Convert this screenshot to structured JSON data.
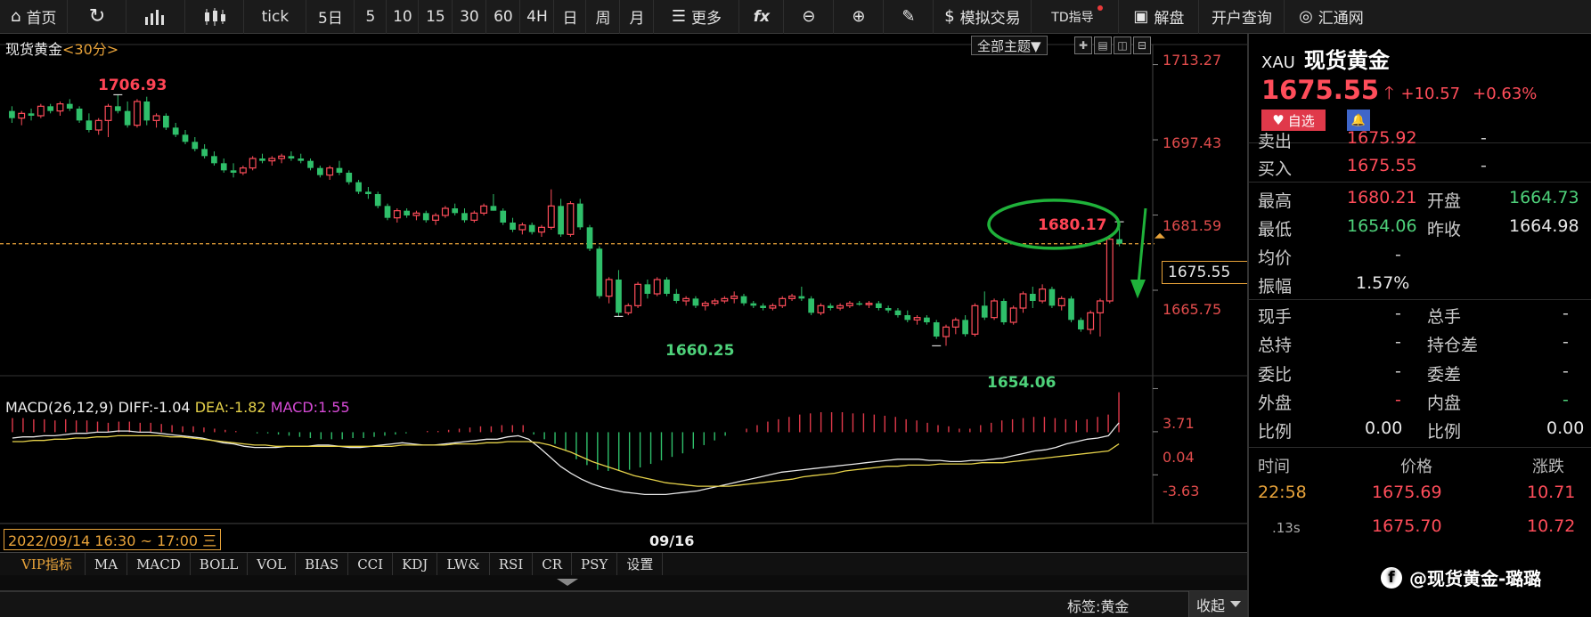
{
  "toolbar": {
    "home": "首页",
    "tick": "tick",
    "periods": [
      "5日",
      "5",
      "10",
      "15",
      "30",
      "60",
      "4H",
      "日",
      "周",
      "月"
    ],
    "more": "更多",
    "fx": "fx",
    "sim_trade": "模拟交易",
    "td_guide": "TD指导",
    "analysis": "解盘",
    "account": "开户查询",
    "huitong": "汇通网"
  },
  "chart": {
    "title": "现货黄金",
    "timeframe": "<30分>",
    "theme_button": "全部主题▼",
    "y_labels": [
      "1713.27",
      "1697.43",
      "1681.59",
      "1665.75"
    ],
    "current_price_box": "1675.55",
    "annotations": {
      "high_left": "1706.93",
      "high_right": "1680.17",
      "low_left": "1660.25",
      "low_right": "1654.06"
    },
    "macd_legend": {
      "params": "MACD(26,12,9)",
      "diff": "DIFF:-1.04",
      "dea": "DEA:-1.82",
      "macd": "MACD:1.55"
    },
    "macd_y_labels": [
      "3.71",
      "0.04",
      "-3.63"
    ],
    "time_start": "2022/09/14 16:30 ~ 17:00 三",
    "time_mid": "09/16"
  },
  "chart_data": {
    "type": "candlestick",
    "title": "现货黄金",
    "ylim": [
      1650,
      1716
    ],
    "yticks": [
      1713.27,
      1697.43,
      1681.59,
      1665.75
    ],
    "current_price": 1675.55,
    "candles": [
      [
        1703.5,
        1704.5,
        1701.0,
        1702.0
      ],
      [
        1702.0,
        1703.5,
        1700.5,
        1703.0
      ],
      [
        1703.0,
        1704.0,
        1701.5,
        1702.5
      ],
      [
        1702.5,
        1705.0,
        1702.0,
        1704.5
      ],
      [
        1704.5,
        1705.0,
        1703.0,
        1703.5
      ],
      [
        1703.5,
        1705.5,
        1702.5,
        1705.0
      ],
      [
        1705.0,
        1706.0,
        1703.5,
        1704.0
      ],
      [
        1704.0,
        1704.5,
        1701.0,
        1701.5
      ],
      [
        1701.5,
        1703.0,
        1699.0,
        1699.5
      ],
      [
        1699.5,
        1702.0,
        1698.5,
        1701.5
      ],
      [
        1701.5,
        1705.0,
        1698.0,
        1704.5
      ],
      [
        1704.5,
        1706.9,
        1703.0,
        1703.5
      ],
      [
        1703.5,
        1705.5,
        1700.0,
        1700.5
      ],
      [
        1700.5,
        1706.0,
        1700.0,
        1705.5
      ],
      [
        1705.5,
        1706.5,
        1700.5,
        1701.5
      ],
      [
        1701.5,
        1703.0,
        1700.0,
        1702.5
      ],
      [
        1702.5,
        1703.0,
        1699.5,
        1700.0
      ],
      [
        1700.0,
        1701.0,
        1698.0,
        1698.5
      ],
      [
        1698.5,
        1699.5,
        1696.5,
        1697.0
      ],
      [
        1697.0,
        1698.0,
        1695.0,
        1695.5
      ],
      [
        1695.5,
        1696.5,
        1693.5,
        1694.0
      ],
      [
        1694.0,
        1695.0,
        1692.0,
        1692.5
      ],
      [
        1692.5,
        1693.5,
        1690.5,
        1691.0
      ],
      [
        1691.0,
        1692.5,
        1689.5,
        1690.5
      ],
      [
        1690.5,
        1692.0,
        1690.0,
        1691.5
      ],
      [
        1691.5,
        1694.0,
        1691.0,
        1693.5
      ],
      [
        1693.5,
        1694.5,
        1692.5,
        1693.0
      ],
      [
        1693.0,
        1694.0,
        1692.0,
        1693.5
      ],
      [
        1693.5,
        1694.5,
        1692.5,
        1694.0
      ],
      [
        1694.0,
        1695.0,
        1693.0,
        1693.5
      ],
      [
        1693.5,
        1694.5,
        1692.5,
        1693.0
      ],
      [
        1693.0,
        1693.5,
        1691.0,
        1691.5
      ],
      [
        1691.5,
        1692.0,
        1689.5,
        1690.0
      ],
      [
        1690.0,
        1692.0,
        1689.0,
        1691.5
      ],
      [
        1691.5,
        1693.0,
        1690.0,
        1690.5
      ],
      [
        1690.5,
        1691.0,
        1688.0,
        1688.5
      ],
      [
        1688.5,
        1689.0,
        1686.0,
        1686.5
      ],
      [
        1686.5,
        1687.5,
        1685.0,
        1686.0
      ],
      [
        1686.0,
        1686.5,
        1683.0,
        1683.5
      ],
      [
        1683.5,
        1684.0,
        1680.5,
        1681.0
      ],
      [
        1681.0,
        1683.0,
        1680.0,
        1682.5
      ],
      [
        1682.5,
        1683.0,
        1681.0,
        1681.5
      ],
      [
        1681.5,
        1682.5,
        1680.5,
        1682.0
      ],
      [
        1682.0,
        1682.5,
        1680.0,
        1680.5
      ],
      [
        1680.5,
        1682.0,
        1679.5,
        1681.5
      ],
      [
        1681.5,
        1683.5,
        1681.0,
        1683.0
      ],
      [
        1683.0,
        1684.0,
        1681.5,
        1682.0
      ],
      [
        1682.0,
        1683.0,
        1680.0,
        1680.5
      ],
      [
        1680.5,
        1682.5,
        1680.0,
        1682.0
      ],
      [
        1682.0,
        1684.0,
        1681.5,
        1683.5
      ],
      [
        1683.5,
        1686.0,
        1682.5,
        1682.5
      ],
      [
        1682.5,
        1683.0,
        1679.5,
        1680.0
      ],
      [
        1680.0,
        1681.0,
        1678.0,
        1678.5
      ],
      [
        1678.5,
        1680.0,
        1677.5,
        1679.5
      ],
      [
        1679.5,
        1680.0,
        1677.5,
        1678.0
      ],
      [
        1678.0,
        1679.5,
        1677.0,
        1679.0
      ],
      [
        1679.0,
        1687.0,
        1678.5,
        1683.5
      ],
      [
        1683.5,
        1685.0,
        1677.0,
        1677.5
      ],
      [
        1677.5,
        1684.5,
        1677.0,
        1684.0
      ],
      [
        1684.0,
        1685.0,
        1678.5,
        1679.0
      ],
      [
        1679.0,
        1679.5,
        1674.0,
        1674.5
      ],
      [
        1674.5,
        1675.0,
        1664.0,
        1664.5
      ],
      [
        1664.5,
        1668.5,
        1663.0,
        1668.0
      ],
      [
        1668.0,
        1670.0,
        1660.25,
        1661.0
      ],
      [
        1661.0,
        1663.0,
        1660.5,
        1662.5
      ],
      [
        1662.5,
        1667.5,
        1662.0,
        1667.0
      ],
      [
        1667.0,
        1668.0,
        1664.0,
        1665.0
      ],
      [
        1665.0,
        1668.5,
        1664.5,
        1668.0
      ],
      [
        1668.0,
        1668.5,
        1664.5,
        1665.0
      ],
      [
        1665.0,
        1666.0,
        1663.0,
        1663.5
      ],
      [
        1663.5,
        1664.5,
        1662.5,
        1664.0
      ],
      [
        1664.0,
        1664.5,
        1662.0,
        1662.5
      ],
      [
        1662.5,
        1663.5,
        1661.5,
        1663.0
      ],
      [
        1663.0,
        1664.0,
        1662.5,
        1663.5
      ],
      [
        1663.5,
        1664.5,
        1663.0,
        1664.0
      ],
      [
        1664.0,
        1665.5,
        1663.0,
        1664.5
      ],
      [
        1664.5,
        1665.0,
        1662.5,
        1663.0
      ],
      [
        1663.0,
        1663.5,
        1662.0,
        1662.5
      ],
      [
        1662.5,
        1663.0,
        1661.5,
        1662.0
      ],
      [
        1662.0,
        1663.0,
        1661.5,
        1662.5
      ],
      [
        1662.5,
        1664.5,
        1662.0,
        1664.0
      ],
      [
        1664.0,
        1665.0,
        1663.5,
        1664.5
      ],
      [
        1664.5,
        1666.5,
        1663.5,
        1664.0
      ],
      [
        1664.0,
        1664.5,
        1660.5,
        1661.0
      ],
      [
        1661.0,
        1663.0,
        1660.5,
        1662.5
      ],
      [
        1662.5,
        1663.0,
        1661.5,
        1662.0
      ],
      [
        1662.0,
        1663.0,
        1661.5,
        1662.5
      ],
      [
        1662.5,
        1663.5,
        1662.0,
        1663.0
      ],
      [
        1663.0,
        1663.5,
        1662.5,
        1662.8
      ],
      [
        1662.8,
        1663.5,
        1662.0,
        1663.0
      ],
      [
        1663.0,
        1663.5,
        1661.5,
        1662.0
      ],
      [
        1662.0,
        1662.5,
        1661.0,
        1661.5
      ],
      [
        1661.5,
        1662.0,
        1660.0,
        1660.5
      ],
      [
        1660.5,
        1661.5,
        1659.0,
        1659.5
      ],
      [
        1659.5,
        1660.5,
        1658.5,
        1660.0
      ],
      [
        1660.0,
        1660.5,
        1658.5,
        1659.0
      ],
      [
        1659.0,
        1659.5,
        1655.5,
        1656.0
      ],
      [
        1656.0,
        1658.5,
        1654.06,
        1658.0
      ],
      [
        1658.0,
        1660.0,
        1656.5,
        1659.5
      ],
      [
        1659.5,
        1660.5,
        1656.0,
        1656.5
      ],
      [
        1656.5,
        1663.0,
        1656.0,
        1662.5
      ],
      [
        1662.5,
        1665.5,
        1659.5,
        1660.0
      ],
      [
        1660.0,
        1664.0,
        1659.5,
        1663.5
      ],
      [
        1663.5,
        1664.0,
        1658.5,
        1659.0
      ],
      [
        1659.0,
        1662.5,
        1658.5,
        1662.0
      ],
      [
        1662.0,
        1665.5,
        1661.0,
        1665.0
      ],
      [
        1665.0,
        1666.5,
        1662.0,
        1663.5
      ],
      [
        1663.5,
        1667.0,
        1663.0,
        1666.0
      ],
      [
        1666.0,
        1666.5,
        1662.0,
        1662.5
      ],
      [
        1662.5,
        1664.5,
        1661.5,
        1664.0
      ],
      [
        1664.0,
        1664.5,
        1659.0,
        1659.5
      ],
      [
        1659.5,
        1660.0,
        1657.0,
        1657.5
      ],
      [
        1657.5,
        1661.5,
        1656.5,
        1661.0
      ],
      [
        1661.0,
        1664.0,
        1656.0,
        1663.5
      ],
      [
        1663.5,
        1677.0,
        1663.0,
        1676.5
      ],
      [
        1676.5,
        1680.17,
        1675.0,
        1675.55
      ]
    ],
    "macd_ylim": [
      -5.5,
      4.2
    ],
    "macd_hist": [
      1.2,
      1.2,
      1.1,
      1.1,
      1.0,
      1.1,
      1.0,
      1.0,
      0.9,
      0.8,
      0.9,
      0.9,
      0.8,
      0.8,
      0.7,
      0.6,
      0.5,
      0.5,
      0.4,
      0.3,
      0.2,
      0.1,
      0.0,
      -0.1,
      -0.1,
      -0.2,
      -0.3,
      -0.4,
      -0.5,
      -0.6,
      -0.6,
      -0.6,
      -0.5,
      -0.5,
      -0.4,
      -0.3,
      -0.2,
      -0.1,
      0.0,
      0.1,
      0.1,
      0.2,
      0.3,
      0.4,
      0.5,
      0.5,
      0.6,
      0.6,
      0.6,
      -0.2,
      -0.6,
      -1.0,
      -1.6,
      -2.3,
      -2.8,
      -3.2,
      -3.3,
      -3.3,
      -3.2,
      -3.0,
      -2.7,
      -2.4,
      -2.1,
      -1.8,
      -1.4,
      -1.1,
      -0.7,
      -0.3,
      0.0,
      0.3,
      0.6,
      0.9,
      1.1,
      1.3,
      1.5,
      1.6,
      1.7,
      1.7,
      1.7,
      1.6,
      1.6,
      1.5,
      1.4,
      1.3,
      1.1,
      1.0,
      0.8,
      0.6,
      0.5,
      0.3,
      0.3,
      0.6,
      0.8,
      1.0,
      1.1,
      1.2,
      1.3,
      1.3,
      1.2,
      1.1,
      1.0,
      1.1,
      1.3,
      1.5,
      3.4
    ],
    "diff": [
      -0.5,
      -0.4,
      -0.4,
      -0.3,
      -0.3,
      -0.2,
      -0.1,
      -0.1,
      0.0,
      0.0,
      0.1,
      0.1,
      0.0,
      0.0,
      -0.1,
      -0.2,
      -0.3,
      -0.4,
      -0.5,
      -0.7,
      -0.9,
      -1.0,
      -1.2,
      -1.3,
      -1.3,
      -1.3,
      -1.2,
      -1.2,
      -1.2,
      -1.1,
      -1.1,
      -1.2,
      -1.3,
      -1.3,
      -1.2,
      -1.1,
      -1.0,
      -0.9,
      -1.0,
      -1.1,
      -1.1,
      -1.0,
      -0.9,
      -0.8,
      -0.7,
      -0.6,
      -0.6,
      -0.4,
      -0.3,
      -0.6,
      -1.3,
      -2.1,
      -2.9,
      -3.5,
      -4.0,
      -4.4,
      -4.7,
      -4.9,
      -5.1,
      -5.2,
      -5.3,
      -5.3,
      -5.3,
      -5.2,
      -5.1,
      -5.0,
      -4.8,
      -4.6,
      -4.4,
      -4.2,
      -4.0,
      -3.8,
      -3.6,
      -3.4,
      -3.3,
      -3.2,
      -3.1,
      -3.0,
      -2.9,
      -2.8,
      -2.7,
      -2.6,
      -2.5,
      -2.4,
      -2.3,
      -2.3,
      -2.3,
      -2.4,
      -2.4,
      -2.5,
      -2.5,
      -2.4,
      -2.4,
      -2.3,
      -2.2,
      -2.0,
      -1.8,
      -1.6,
      -1.5,
      -1.3,
      -1.0,
      -0.8,
      -0.6,
      -0.5,
      -0.3,
      0.8
    ],
    "dea": [
      -0.8,
      -0.8,
      -0.7,
      -0.7,
      -0.6,
      -0.6,
      -0.5,
      -0.5,
      -0.4,
      -0.4,
      -0.3,
      -0.3,
      -0.3,
      -0.3,
      -0.3,
      -0.4,
      -0.4,
      -0.5,
      -0.6,
      -0.7,
      -0.8,
      -0.9,
      -1.0,
      -1.1,
      -1.1,
      -1.2,
      -1.2,
      -1.2,
      -1.2,
      -1.2,
      -1.2,
      -1.2,
      -1.2,
      -1.2,
      -1.2,
      -1.2,
      -1.2,
      -1.1,
      -1.1,
      -1.1,
      -1.1,
      -1.1,
      -1.0,
      -1.0,
      -1.0,
      -0.9,
      -0.9,
      -0.8,
      -0.8,
      -0.8,
      -0.9,
      -1.1,
      -1.4,
      -1.7,
      -2.1,
      -2.5,
      -2.8,
      -3.1,
      -3.4,
      -3.7,
      -3.9,
      -4.1,
      -4.3,
      -4.4,
      -4.5,
      -4.6,
      -4.6,
      -4.6,
      -4.6,
      -4.5,
      -4.4,
      -4.3,
      -4.2,
      -4.1,
      -4.0,
      -3.8,
      -3.7,
      -3.6,
      -3.5,
      -3.3,
      -3.2,
      -3.1,
      -3.0,
      -2.9,
      -2.9,
      -2.8,
      -2.8,
      -2.8,
      -2.7,
      -2.7,
      -2.7,
      -2.7,
      -2.6,
      -2.6,
      -2.6,
      -2.5,
      -2.4,
      -2.3,
      -2.2,
      -2.1,
      -2.0,
      -1.9,
      -1.8,
      -1.7,
      -1.6,
      -1.0
    ]
  },
  "panel": {
    "code": "XAU",
    "name": "现货黄金",
    "price": "1675.55",
    "change": "+10.57",
    "change_pct": "+0.63%",
    "fav": "自选",
    "sell_label": "卖出",
    "sell_value": "1675.92",
    "sell_extra": "-",
    "buy_label": "买入",
    "buy_value": "1675.55",
    "buy_extra": "-",
    "high_label": "最高",
    "high_value": "1680.21",
    "open_label": "开盘",
    "open_value": "1664.73",
    "low_label": "最低",
    "low_value": "1654.06",
    "prev_label": "昨收",
    "prev_value": "1664.98",
    "avg_label": "均价",
    "avg_value": "-",
    "amp_label": "振幅",
    "amp_value": "1.57%",
    "now_hand_label": "现手",
    "now_hand_value": "-",
    "total_hand_label": "总手",
    "total_hand_value": "-",
    "total_hold_label": "总持",
    "total_hold_value": "-",
    "hold_diff_label": "持仓差",
    "hold_diff_value": "-",
    "ratio_label": "委比",
    "ratio_value": "-",
    "diff_label": "委差",
    "diff_value": "-",
    "outer_label": "外盘",
    "outer_value": "-",
    "inner_label": "内盘",
    "inner_value": "-",
    "prop1_label": "比例",
    "prop1_value": "0.00",
    "prop2_label": "比例",
    "prop2_value": "0.00",
    "tick_headers": [
      "时间",
      "价格",
      "涨跌"
    ],
    "ticks": [
      {
        "time": "22:58",
        "price": "1675.69",
        "chg": "10.71"
      },
      {
        "time": ".13s",
        "price": "1675.70",
        "chg": "10.72"
      }
    ]
  },
  "tabs": [
    "VIP指标",
    "MA",
    "MACD",
    "BOLL",
    "VOL",
    "BIAS",
    "CCI",
    "KDJ",
    "LW&",
    "RSI",
    "CR",
    "PSY",
    "设置"
  ],
  "status": {
    "tag": "标签:黄金",
    "fold": "收起"
  },
  "watermark": "@现货黄金-璐璐",
  "colors": {
    "up": "#ff4d5a",
    "down": "#2fbf6a",
    "accent": "#e8a33a",
    "dea": "#e6d24a",
    "macd_label": "#d74bd7"
  }
}
